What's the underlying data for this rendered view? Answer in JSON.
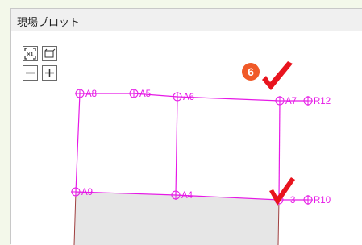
{
  "window": {
    "title": "現場プロット"
  },
  "toolbar": {
    "zoom_1x_icon": "fit-1x-icon",
    "select_area_icon": "select-area-icon",
    "zoom_out_icon": "minus-icon",
    "zoom_in_icon": "plus-icon"
  },
  "plot": {
    "line_color": "#e619e6",
    "fill_color": "#e6e6e6",
    "points": {
      "A8": "A8",
      "A5": "A5",
      "A6": "A6",
      "A7": "A7",
      "R12": "R12",
      "A9": "A9",
      "A4": "A4",
      "A3": "3",
      "R10": "R10"
    }
  },
  "annotations": {
    "step_number": "6",
    "badge_color": "#f05a28",
    "check_color": "#e8141e"
  }
}
